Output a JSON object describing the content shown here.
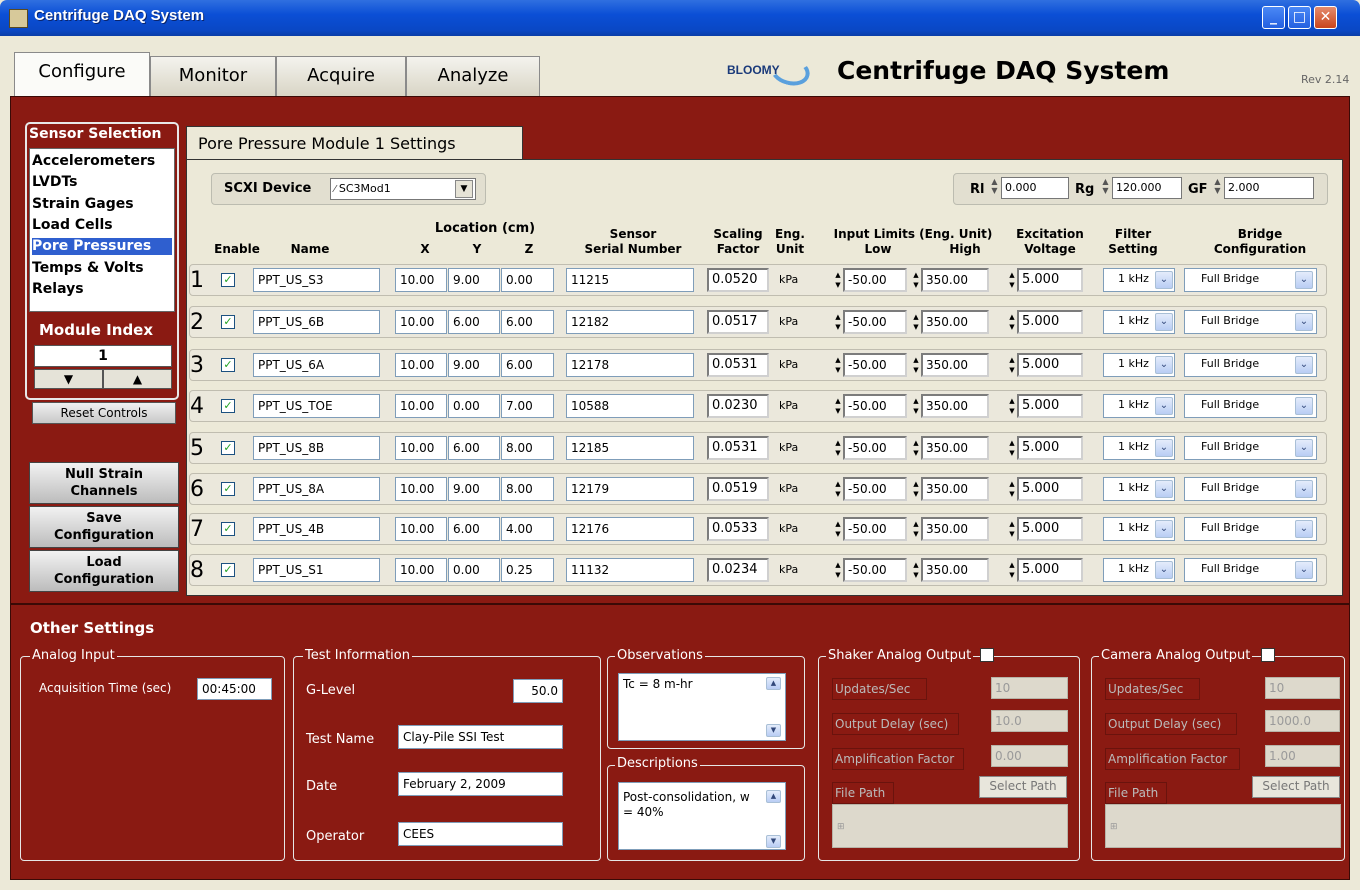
{
  "window": {
    "title": "Centrifuge DAQ System"
  },
  "tabs": [
    "Configure",
    "Monitor",
    "Acquire",
    "Analyze"
  ],
  "header": {
    "logo_text": "BLOOMY",
    "app_title": "Centrifuge DAQ System",
    "revision": "Rev 2.14"
  },
  "sensor_selection": {
    "title": "Sensor Selection",
    "items": [
      "Accelerometers",
      "LVDTs",
      "Strain Gages",
      "Load Cells",
      "Pore Pressures",
      "Temps & Volts",
      "Relays"
    ],
    "selected": "Pore Pressures"
  },
  "module_index": {
    "label": "Module Index",
    "value": "1"
  },
  "buttons": {
    "reset": "Reset Controls",
    "null_strain": "Null Strain Channels",
    "save_config": "Save Configuration",
    "load_config": "Load Configuration"
  },
  "module_settings": {
    "tab_title": "Pore Pressure Module 1 Settings",
    "scxi_label": "SCXI Device",
    "scxi_value": "SC3Mod1",
    "rl_label": "Rl",
    "rl_value": "0.000",
    "rg_label": "Rg",
    "rg_value": "120.000",
    "gf_label": "GF",
    "gf_value": "2.000"
  },
  "headers": {
    "enable": "Enable",
    "name": "Name",
    "location": "Location (cm)",
    "x": "X",
    "y": "Y",
    "z": "Z",
    "serial_1": "Sensor",
    "serial_2": "Serial Number",
    "scaling_1": "Scaling",
    "scaling_2": "Factor",
    "eng_1": "Eng.",
    "eng_2": "Unit",
    "limits": "Input Limits (Eng. Unit)",
    "low": "Low",
    "high": "High",
    "excitation_1": "Excitation",
    "excitation_2": "Voltage",
    "filter_1": "Filter",
    "filter_2": "Setting",
    "bridge_1": "Bridge",
    "bridge_2": "Configuration"
  },
  "channels": [
    {
      "num": "1",
      "name": "PPT_US_S3",
      "x": "10.00",
      "y": "9.00",
      "z": "0.00",
      "serial": "11215",
      "scale": "0.0520",
      "unit": "kPa",
      "low": "-50.00",
      "high": "350.00",
      "exc": "5.000",
      "filter": "1 kHz",
      "bridge": "Full Bridge"
    },
    {
      "num": "2",
      "name": "PPT_US_6B",
      "x": "10.00",
      "y": "6.00",
      "z": "6.00",
      "serial": "12182",
      "scale": "0.0517",
      "unit": "kPa",
      "low": "-50.00",
      "high": "350.00",
      "exc": "5.000",
      "filter": "1 kHz",
      "bridge": "Full Bridge"
    },
    {
      "num": "3",
      "name": "PPT_US_6A",
      "x": "10.00",
      "y": "9.00",
      "z": "6.00",
      "serial": "12178",
      "scale": "0.0531",
      "unit": "kPa",
      "low": "-50.00",
      "high": "350.00",
      "exc": "5.000",
      "filter": "1 kHz",
      "bridge": "Full Bridge"
    },
    {
      "num": "4",
      "name": "PPT_US_TOE",
      "x": "10.00",
      "y": "0.00",
      "z": "7.00",
      "serial": "10588",
      "scale": "0.0230",
      "unit": "kPa",
      "low": "-50.00",
      "high": "350.00",
      "exc": "5.000",
      "filter": "1 kHz",
      "bridge": "Full Bridge"
    },
    {
      "num": "5",
      "name": "PPT_US_8B",
      "x": "10.00",
      "y": "6.00",
      "z": "8.00",
      "serial": "12185",
      "scale": "0.0531",
      "unit": "kPa",
      "low": "-50.00",
      "high": "350.00",
      "exc": "5.000",
      "filter": "1 kHz",
      "bridge": "Full Bridge"
    },
    {
      "num": "6",
      "name": "PPT_US_8A",
      "x": "10.00",
      "y": "9.00",
      "z": "8.00",
      "serial": "12179",
      "scale": "0.0519",
      "unit": "kPa",
      "low": "-50.00",
      "high": "350.00",
      "exc": "5.000",
      "filter": "1 kHz",
      "bridge": "Full Bridge"
    },
    {
      "num": "7",
      "name": "PPT_US_4B",
      "x": "10.00",
      "y": "6.00",
      "z": "4.00",
      "serial": "12176",
      "scale": "0.0533",
      "unit": "kPa",
      "low": "-50.00",
      "high": "350.00",
      "exc": "5.000",
      "filter": "1 kHz",
      "bridge": "Full Bridge"
    },
    {
      "num": "8",
      "name": "PPT_US_S1",
      "x": "10.00",
      "y": "0.00",
      "z": "0.25",
      "serial": "11132",
      "scale": "0.0234",
      "unit": "kPa",
      "low": "-50.00",
      "high": "350.00",
      "exc": "5.000",
      "filter": "1 kHz",
      "bridge": "Full Bridge"
    }
  ],
  "other": {
    "title": "Other Settings",
    "analog_input": {
      "title": "Analog Input",
      "acq_label": "Acquisition Time (sec)",
      "acq_value": "00:45:00"
    },
    "test_info": {
      "title": "Test Information",
      "glevel_label": "G-Level",
      "glevel": "50.0",
      "name_label": "Test Name",
      "name": "Clay-Pile SSI Test",
      "date_label": "Date",
      "date": "February 2, 2009",
      "operator_label": "Operator",
      "operator": "CEES"
    },
    "observations": {
      "title": "Observations",
      "text": "Tc = 8 m-hr"
    },
    "descriptions": {
      "title": "Descriptions",
      "text": "Post-consolidation, w = 40%"
    },
    "shaker": {
      "title": "Shaker Analog Output",
      "updates_label": "Updates/Sec",
      "updates": "10",
      "delay_label": "Output Delay (sec)",
      "delay": "10.0",
      "amp_label": "Amplification Factor",
      "amp": "0.00",
      "path_btn": "Select Path",
      "path_label": "File Path"
    },
    "camera": {
      "title": "Camera Analog Output",
      "updates_label": "Updates/Sec",
      "updates": "10",
      "delay_label": "Output Delay (sec)",
      "delay": "1000.0",
      "amp_label": "Amplification Factor",
      "amp": "1.00",
      "path_btn": "Select Path",
      "path_label": "File Path"
    }
  }
}
